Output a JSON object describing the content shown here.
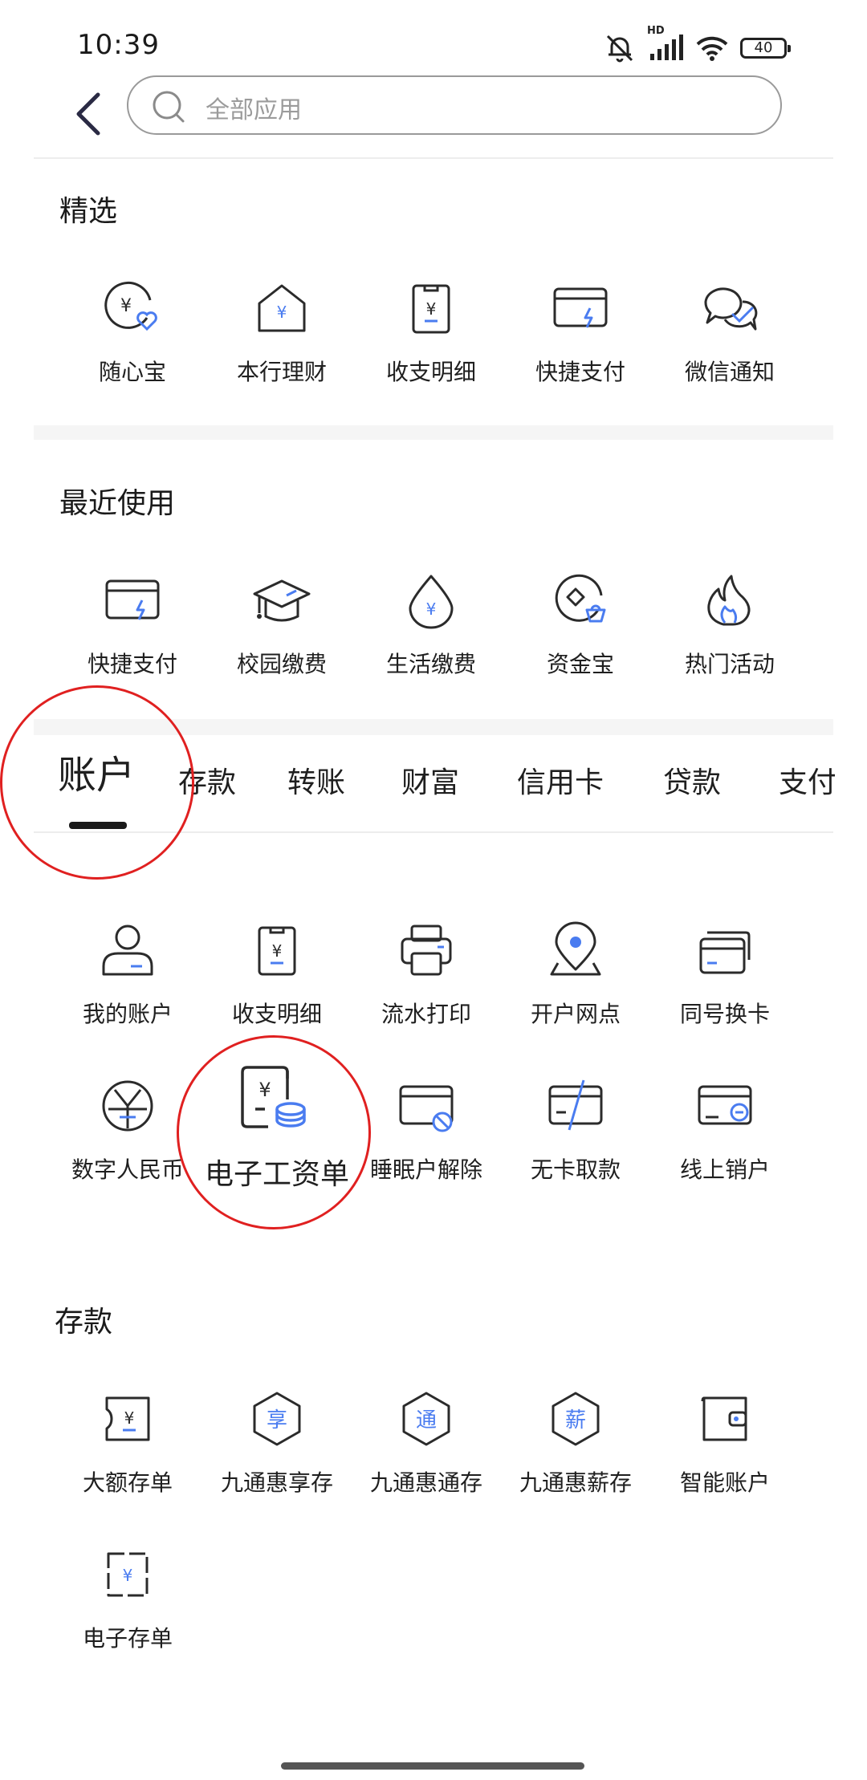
{
  "status_bar": {
    "time": "10:39",
    "network_label": "HD",
    "battery": "40"
  },
  "header": {
    "search_placeholder": "全部应用"
  },
  "featured": {
    "title": "精选",
    "items": [
      {
        "label": "随心宝",
        "icon": "yuan-heart-coin-icon"
      },
      {
        "label": "本行理财",
        "icon": "yuan-house-icon"
      },
      {
        "label": "收支明细",
        "icon": "yuan-clipboard-icon"
      },
      {
        "label": "快捷支付",
        "icon": "card-lightning-icon"
      },
      {
        "label": "微信通知",
        "icon": "chat-check-icon"
      }
    ]
  },
  "recent": {
    "title": "最近使用",
    "items": [
      {
        "label": "快捷支付",
        "icon": "card-lightning-icon"
      },
      {
        "label": "校园缴费",
        "icon": "graduation-cap-icon"
      },
      {
        "label": "生活缴费",
        "icon": "yuan-drop-icon"
      },
      {
        "label": "资金宝",
        "icon": "coin-basket-icon"
      },
      {
        "label": "热门活动",
        "icon": "flame-icon"
      }
    ]
  },
  "tabs": [
    {
      "label": "账户",
      "active": true
    },
    {
      "label": "存款",
      "active": false
    },
    {
      "label": "转账",
      "active": false
    },
    {
      "label": "财富",
      "active": false
    },
    {
      "label": "信用卡",
      "active": false
    },
    {
      "label": "贷款",
      "active": false
    },
    {
      "label": "支付",
      "active": false
    }
  ],
  "account": {
    "items": [
      {
        "label": "我的账户",
        "icon": "user-icon"
      },
      {
        "label": "收支明细",
        "icon": "yuan-clipboard-icon"
      },
      {
        "label": "流水打印",
        "icon": "printer-icon"
      },
      {
        "label": "开户网点",
        "icon": "location-pin-icon"
      },
      {
        "label": "同号换卡",
        "icon": "stacked-cards-icon"
      },
      {
        "label": "数字人民币",
        "icon": "digital-yuan-icon"
      },
      {
        "label": "电子工资单",
        "icon": "payslip-coins-icon"
      },
      {
        "label": "睡眠户解除",
        "icon": "card-block-icon"
      },
      {
        "label": "无卡取款",
        "icon": "card-slash-icon"
      },
      {
        "label": "线上销户",
        "icon": "card-minus-icon"
      }
    ]
  },
  "deposit": {
    "title": "存款",
    "items": [
      {
        "label": "大额存单",
        "icon": "yuan-certificate-icon"
      },
      {
        "label": "九通惠享存",
        "icon": "hexagon-xiang-icon",
        "glyph": "享"
      },
      {
        "label": "九通惠通存",
        "icon": "hexagon-tong-icon",
        "glyph": "通"
      },
      {
        "label": "九通惠薪存",
        "icon": "hexagon-xin-icon",
        "glyph": "薪"
      },
      {
        "label": "智能账户",
        "icon": "wallet-icon"
      },
      {
        "label": "电子存单",
        "icon": "yuan-receipt-icon"
      }
    ]
  },
  "colors": {
    "accent": "#4a7cf0",
    "icon_stroke": "#2b2b2b",
    "annotation": "#e02020"
  }
}
